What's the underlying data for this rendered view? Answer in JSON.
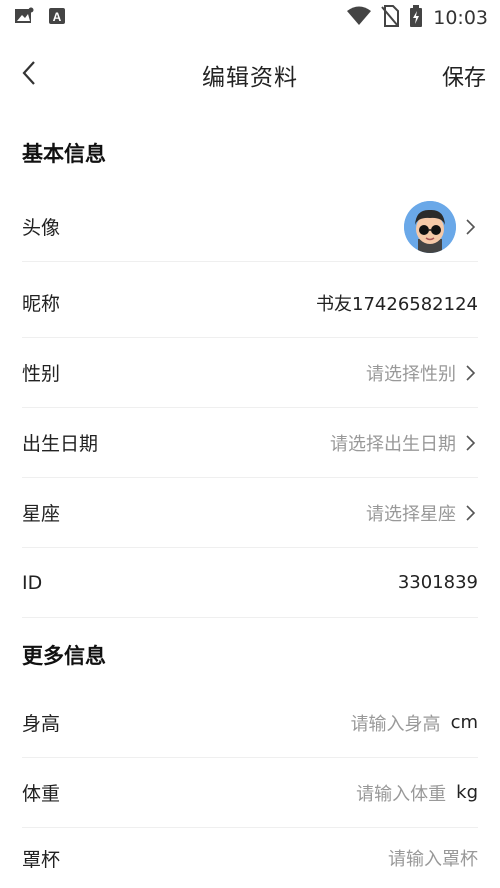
{
  "status_bar": {
    "time": "10:03",
    "icons": [
      "gallery-icon",
      "font-icon",
      "wifi-icon",
      "no-sim-icon",
      "battery-charging-icon"
    ]
  },
  "header": {
    "title": "编辑资料",
    "save_label": "保存",
    "back_icon": "chevron-left-icon"
  },
  "basic_info": {
    "section_title": "基本信息",
    "avatar_label": "头像",
    "nickname_label": "昵称",
    "nickname_value": "书友17426582124",
    "gender_label": "性别",
    "gender_placeholder": "请选择性别",
    "birthday_label": "出生日期",
    "birthday_placeholder": "请选择出生日期",
    "zodiac_label": "星座",
    "zodiac_placeholder": "请选择星座",
    "id_label": "ID",
    "id_value": "3301839"
  },
  "more_info": {
    "section_title": "更多信息",
    "height_label": "身高",
    "height_placeholder": "请输入身高",
    "height_unit": "cm",
    "weight_label": "体重",
    "weight_placeholder": "请输入体重",
    "weight_unit": "kg",
    "cup_label": "罩杯",
    "cup_placeholder": "请输入罩杯"
  }
}
